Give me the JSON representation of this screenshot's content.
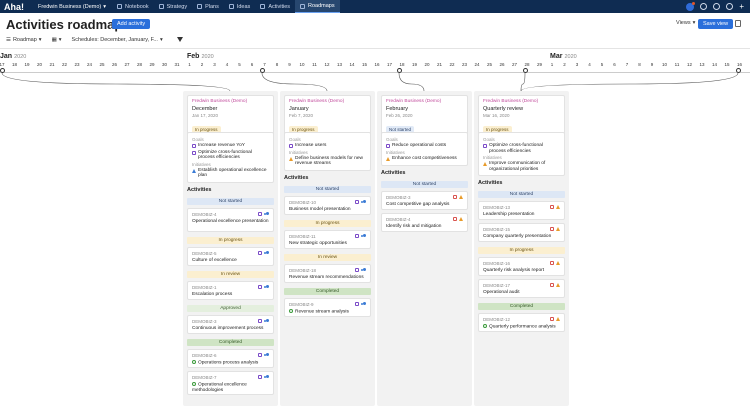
{
  "topbar": {
    "logo": "Aha!",
    "workspace": "Fredwin Business (Demo)",
    "nav": [
      "Notebook",
      "Strategy",
      "Plans",
      "Ideas",
      "Activities",
      "Roadmaps"
    ]
  },
  "page": {
    "title": "Activities roadmap",
    "add_button": "Add activity",
    "views_label": "Views",
    "save_view_label": "Save view"
  },
  "toolbar": {
    "view": "Roadmap",
    "schedules": "Schedules: December, January, F..."
  },
  "timeline": {
    "months": [
      {
        "name": "Jan",
        "year": "2020"
      },
      {
        "name": "Feb",
        "year": "2020"
      },
      {
        "name": "Mar",
        "year": "2020"
      }
    ],
    "days": [
      "17",
      "18",
      "19",
      "20",
      "21",
      "22",
      "23",
      "24",
      "25",
      "26",
      "27",
      "28",
      "29",
      "30",
      "31",
      "1",
      "2",
      "3",
      "4",
      "5",
      "6",
      "7",
      "8",
      "9",
      "10",
      "11",
      "12",
      "13",
      "14",
      "15",
      "16",
      "17",
      "18",
      "19",
      "20",
      "21",
      "22",
      "23",
      "24",
      "25",
      "26",
      "27",
      "28",
      "29",
      "1",
      "2",
      "3",
      "4",
      "5",
      "6",
      "7",
      "8",
      "9",
      "10",
      "11",
      "12",
      "13",
      "14",
      "15",
      "16"
    ]
  },
  "labels": {
    "goals": "Goals",
    "initiatives": "Initiatives",
    "activities": "Activities"
  },
  "lanes": [
    {
      "workspace": "Fredwin Business (Demo)",
      "name": "December",
      "date": "Jan 17, 2020",
      "status": "In progress",
      "goals": [
        "Increase revenue YoY",
        "Optimize cross-functional process efficiencies"
      ],
      "initiatives": [
        "Establish operational excellence plan"
      ],
      "groups": [
        {
          "label": "Not started",
          "cards": [
            {
              "id": "DEMOBIZ-4",
              "name": "Operational excellence presentation"
            }
          ]
        },
        {
          "label": "In progress",
          "cards": [
            {
              "id": "DEMOBIZ-5",
              "name": "Culture of excellence"
            }
          ]
        },
        {
          "label": "In review",
          "cards": [
            {
              "id": "DEMOBIZ-1",
              "name": "Escalation process"
            }
          ]
        },
        {
          "label": "Approved",
          "cards": [
            {
              "id": "DEMOBIZ-3",
              "name": "Continuous improvement process"
            }
          ]
        },
        {
          "label": "Completed",
          "cards": [
            {
              "id": "DEMOBIZ-6",
              "name": "Operations process analysis"
            },
            {
              "id": "DEMOBIZ-7",
              "name": "Operational excellence methodologies"
            }
          ]
        }
      ]
    },
    {
      "workspace": "Fredwin Business (Demo)",
      "name": "January",
      "date": "Feb 7, 2020",
      "status": "In progress",
      "goals": [
        "Increase users"
      ],
      "initiatives": [
        "Define business models for new revenue streams"
      ],
      "groups": [
        {
          "label": "Not started",
          "cards": [
            {
              "id": "DEMOBIZ-10",
              "name": "Business model presentation"
            }
          ]
        },
        {
          "label": "In progress",
          "cards": [
            {
              "id": "DEMOBIZ-11",
              "name": "New strategic opportunities"
            }
          ]
        },
        {
          "label": "In review",
          "cards": [
            {
              "id": "DEMOBIZ-18",
              "name": "Revenue stream recommendations"
            }
          ]
        },
        {
          "label": "Completed",
          "cards": [
            {
              "id": "DEMOBIZ-9",
              "name": "Revenue stream analysis"
            }
          ]
        }
      ]
    },
    {
      "workspace": "Fredwin Business (Demo)",
      "name": "February",
      "date": "Feb 26, 2020",
      "status": "Not started",
      "goals": [
        "Reduce operational costs"
      ],
      "initiatives": [
        "Enhance cost competitiveness"
      ],
      "groups": [
        {
          "label": "Not started",
          "cards": [
            {
              "id": "DEMOBIZ-3",
              "name": "Cost competitive gap analysis"
            },
            {
              "id": "DEMOBIZ-4",
              "name": "Identify risk and mitigation"
            }
          ]
        }
      ]
    },
    {
      "workspace": "Fredwin Business (Demo)",
      "name": "Quarterly review",
      "date": "Mar 16, 2020",
      "status": "In progress",
      "goals": [
        "Optimize cross-functional process efficiencies"
      ],
      "initiatives": [
        "Improve communication of organizational priorities"
      ],
      "groups": [
        {
          "label": "Not started",
          "cards": [
            {
              "id": "DEMOBIZ-13",
              "name": "Leadership presentation"
            },
            {
              "id": "DEMOBIZ-15",
              "name": "Company quarterly presentation"
            }
          ]
        },
        {
          "label": "In progress",
          "cards": [
            {
              "id": "DEMOBIZ-16",
              "name": "Quarterly risk analysis report"
            },
            {
              "id": "DEMOBIZ-17",
              "name": "Operational audit"
            }
          ]
        },
        {
          "label": "Completed",
          "cards": [
            {
              "id": "DEMOBIZ-12",
              "name": "Quarterly performance analysis"
            }
          ]
        }
      ]
    }
  ]
}
